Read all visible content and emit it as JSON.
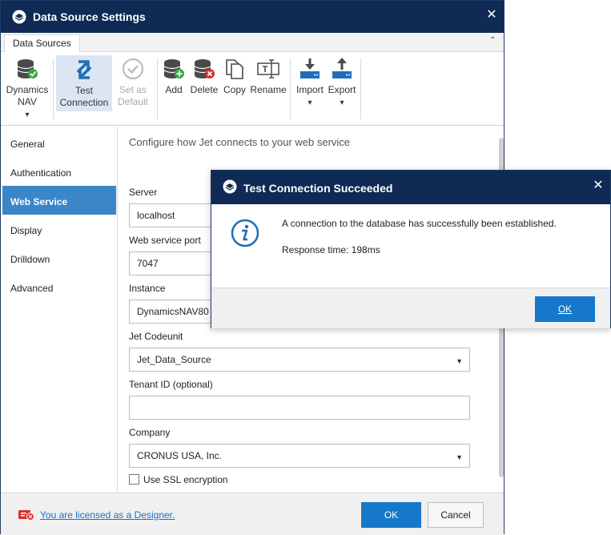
{
  "window": {
    "title": "Data Source Settings",
    "close": "✕"
  },
  "ribbon": {
    "tab": "Data Sources",
    "buttons": {
      "dynamics_nav": "Dynamics NAV",
      "dynamics_nav_arrow": "▾",
      "test_connection_line1": "Test",
      "test_connection_line2": "Connection",
      "set_default_line1": "Set as",
      "set_default_line2": "Default",
      "add": "Add",
      "delete": "Delete",
      "copy": "Copy",
      "rename": "Rename",
      "import": "Import",
      "export": "Export",
      "dropdown_arrow": "▾"
    },
    "collapse_glyph": "⌃"
  },
  "sidebar": {
    "items": [
      "General",
      "Authentication",
      "Web Service",
      "Display",
      "Drilldown",
      "Advanced"
    ],
    "active": "Web Service"
  },
  "content": {
    "heading": "Configure how Jet connects to your web service",
    "fields": {
      "server": {
        "label": "Server",
        "value": "localhost"
      },
      "port": {
        "label": "Web service port",
        "value": "7047"
      },
      "instance": {
        "label": "Instance",
        "value": "DynamicsNAV80"
      },
      "codeunit": {
        "label": "Jet Codeunit",
        "value": "Jet_Data_Source"
      },
      "tenant": {
        "label": "Tenant ID (optional)",
        "value": ""
      },
      "company": {
        "label": "Company",
        "value": "CRONUS USA, Inc."
      }
    },
    "ssl_label": "Use SSL encryption",
    "dropdown_arrow": "▼"
  },
  "footer": {
    "license_link": "You are licensed as a Designer.",
    "ok": "OK",
    "cancel": "Cancel"
  },
  "modal": {
    "title": "Test Connection Succeeded",
    "close": "✕",
    "message": "A connection to the database has successfully been established.",
    "response": "Response time: 198ms",
    "ok": "OK"
  },
  "colors": {
    "titlebar": "#0e2a55",
    "accent": "#1678c8",
    "sidebar_active": "#3a86c8",
    "success_badge": "#3aa845",
    "error_badge": "#d9302c"
  }
}
